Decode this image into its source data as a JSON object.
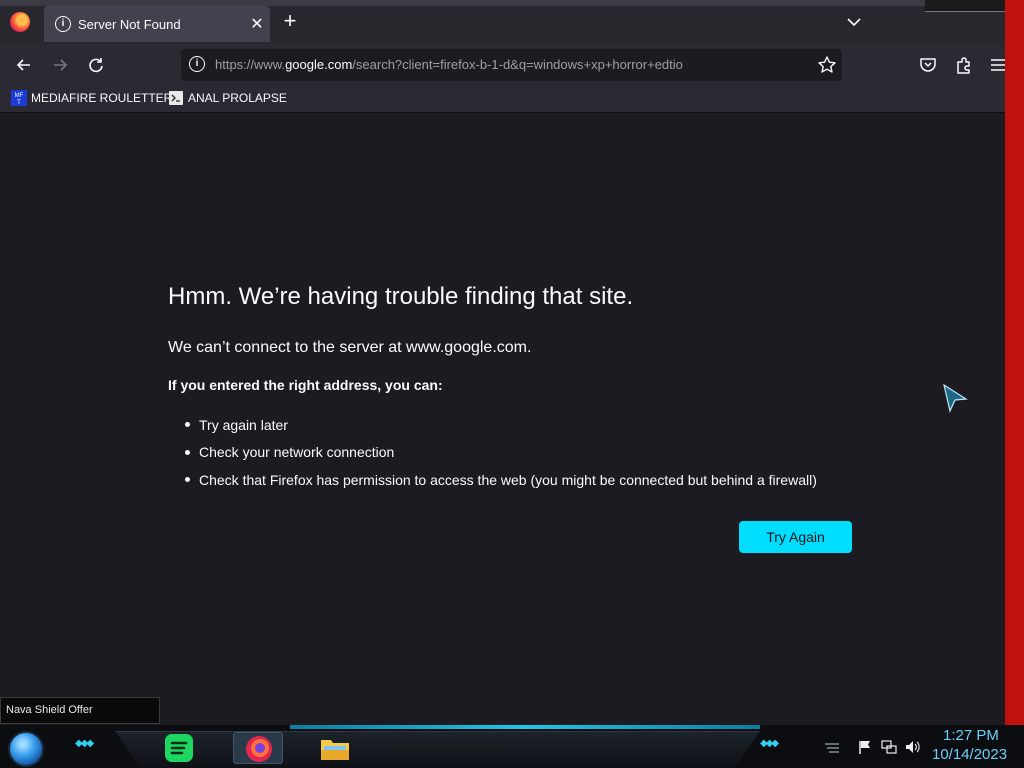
{
  "browser": {
    "tab": {
      "title": "Server Not Found"
    },
    "url": {
      "prefix": "https://www.",
      "domain": "google.com",
      "suffix": "/search?client=firefox-b-1-d&q=windows+xp+horror+edtio"
    },
    "bookmarks": [
      {
        "label": "MEDIAFIRE ROULETTER",
        "icon": "mediafire-icon"
      },
      {
        "label": "ANAL PROLAPSE",
        "icon": "terminal-icon"
      }
    ]
  },
  "error_page": {
    "title": "Hmm. We’re having trouble finding that site.",
    "subtitle": "We can’t connect to the server at www.google.com.",
    "lead": "If you entered the right address, you can:",
    "suggestions": [
      "Try again later",
      "Check your network connection",
      "Check that Firefox has permission to access the web (you might be connected but behind a firewall)"
    ],
    "button_label": "Try Again",
    "accent": "#00ddff"
  },
  "status_tip": "Nava Shield Offer",
  "taskbar": {
    "time": "1:27 PM",
    "date": "10/14/2023",
    "apps": [
      "spotify-icon",
      "firefox-icon",
      "file-explorer-icon"
    ]
  }
}
